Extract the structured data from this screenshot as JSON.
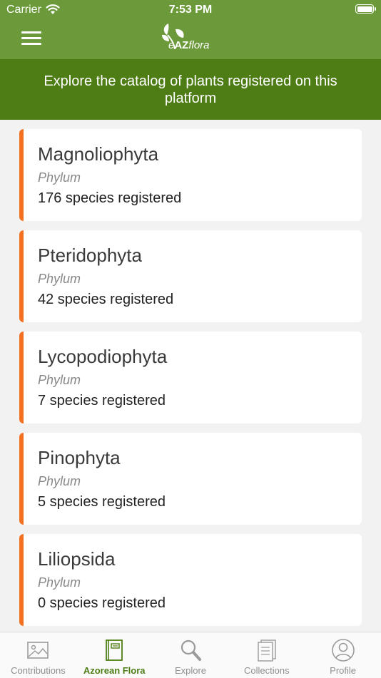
{
  "status_bar": {
    "carrier": "Carrier",
    "time": "7:53 PM"
  },
  "header": {
    "logo_text_prefix": "e",
    "logo_text_bold": "AZ",
    "logo_text_suffix": "flora"
  },
  "banner": {
    "text": "Explore the catalog of plants registered on this platform"
  },
  "phyla": [
    {
      "name": "Magnoliophyta",
      "rank": "Phylum",
      "count": "176 species registered"
    },
    {
      "name": "Pteridophyta",
      "rank": "Phylum",
      "count": "42 species registered"
    },
    {
      "name": "Lycopodiophyta",
      "rank": "Phylum",
      "count": "7 species registered"
    },
    {
      "name": "Pinophyta",
      "rank": "Phylum",
      "count": "5 species registered"
    },
    {
      "name": "Liliopsida",
      "rank": "Phylum",
      "count": "0 species registered"
    }
  ],
  "tabs": [
    {
      "label": "Contributions",
      "icon": "image-icon"
    },
    {
      "label": "Azorean Flora",
      "icon": "book-icon",
      "active": true
    },
    {
      "label": "Explore",
      "icon": "magnifier-icon"
    },
    {
      "label": "Collections",
      "icon": "document-icon"
    },
    {
      "label": "Profile",
      "icon": "user-icon"
    }
  ],
  "colors": {
    "header": "#6c9a3b",
    "banner": "#4e7d15",
    "accent_bar": "#f37021",
    "active_tab": "#4e7d15"
  }
}
